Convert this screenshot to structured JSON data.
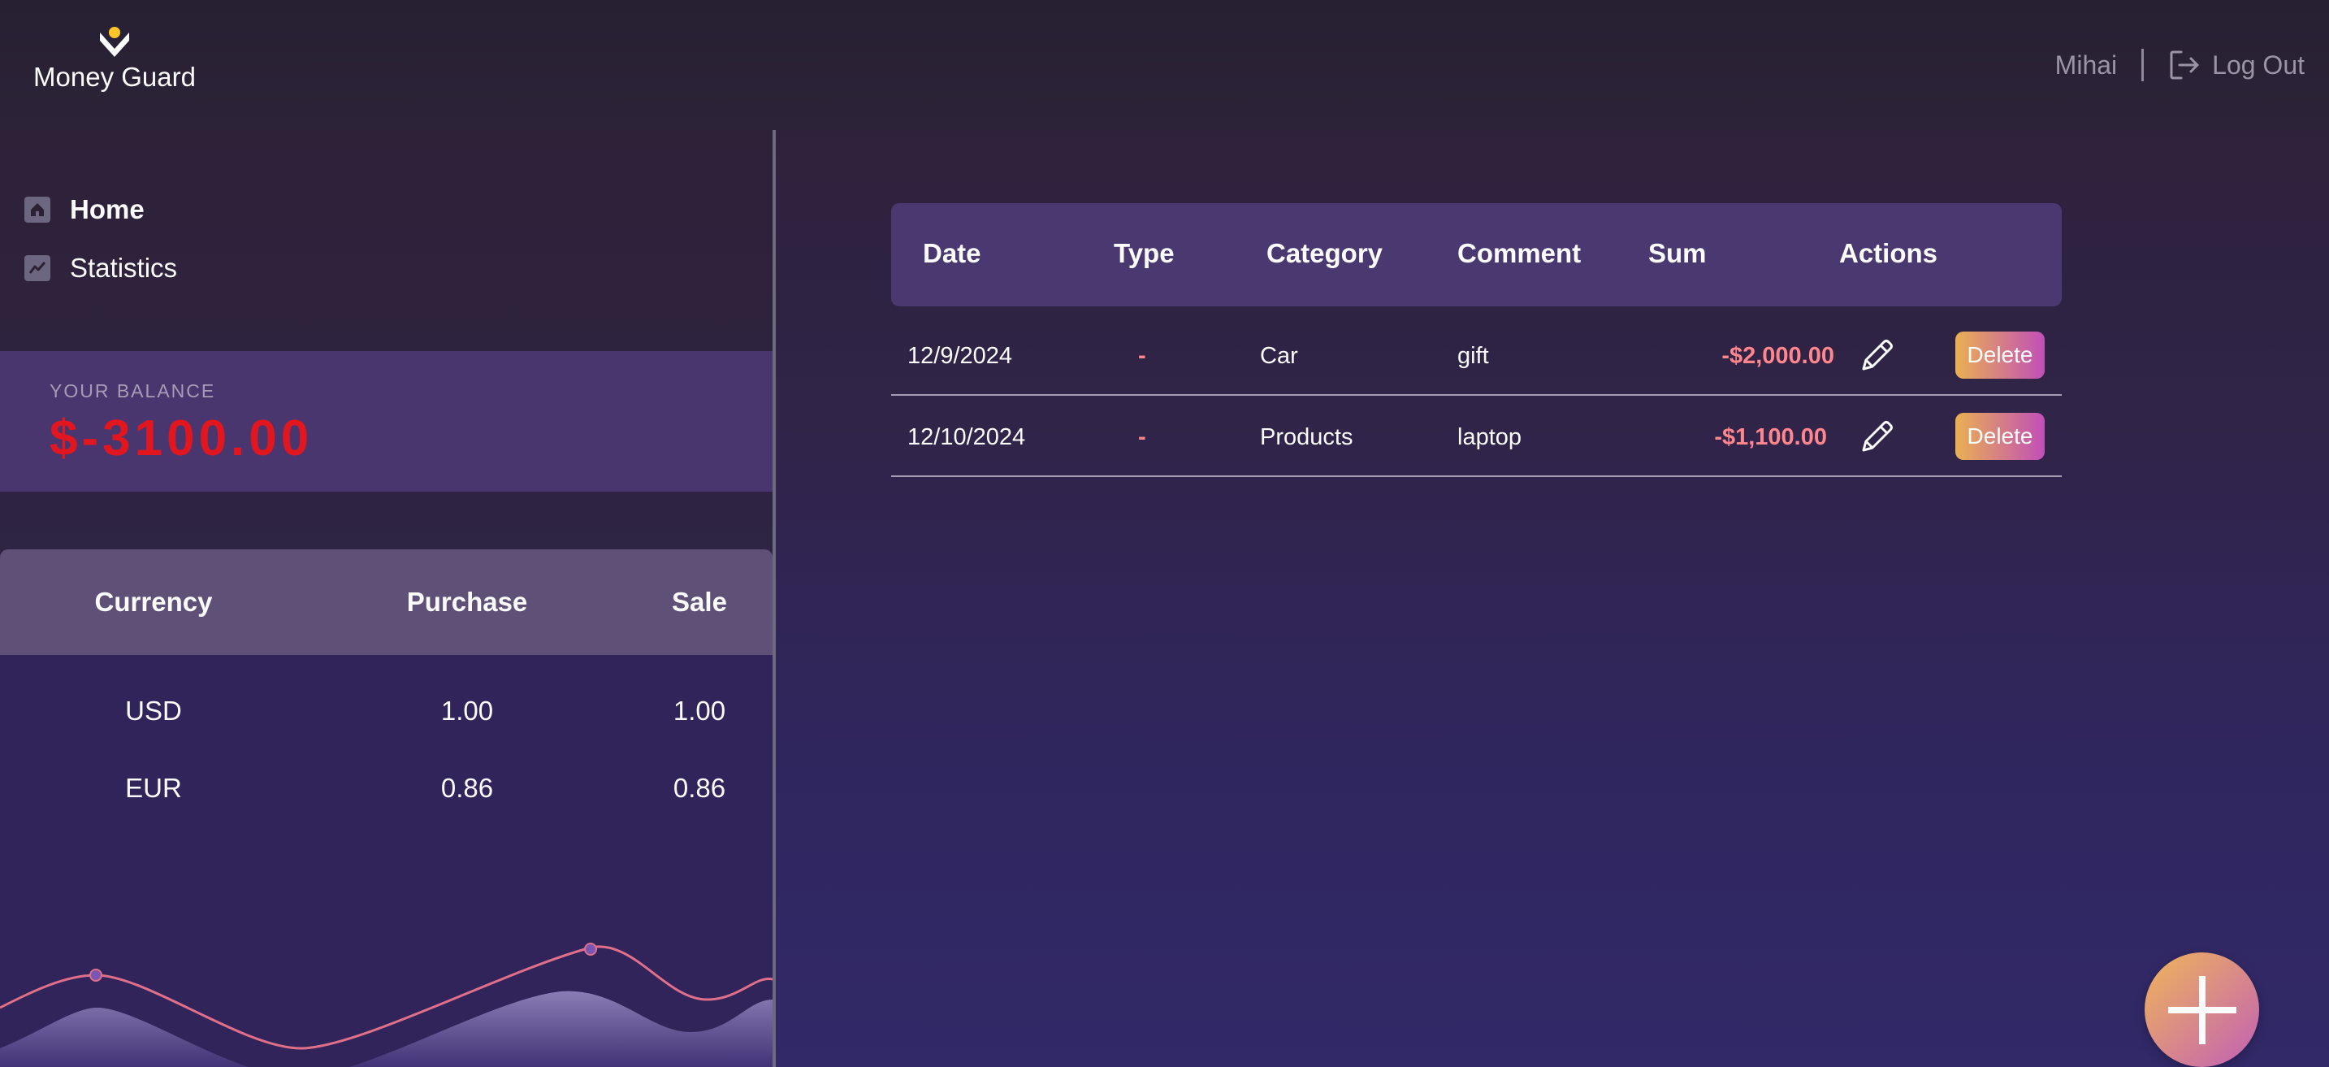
{
  "app": {
    "name": "Money Guard"
  },
  "header": {
    "username": "Mihai",
    "logout_label": "Log Out"
  },
  "sidebar": {
    "nav": [
      {
        "label": "Home",
        "icon": "home-icon",
        "active": true
      },
      {
        "label": "Statistics",
        "icon": "chart-icon",
        "active": false
      }
    ]
  },
  "balance": {
    "label": "YOUR BALANCE",
    "value": "$-3100.00"
  },
  "currency": {
    "headers": [
      "Currency",
      "Purchase",
      "Sale"
    ],
    "rows": [
      {
        "currency": "USD",
        "purchase": "1.00",
        "sale": "1.00"
      },
      {
        "currency": "EUR",
        "purchase": "0.86",
        "sale": "0.86"
      }
    ]
  },
  "transactions": {
    "headers": [
      "Date",
      "Type",
      "Category",
      "Comment",
      "Sum",
      "Actions"
    ],
    "rows": [
      {
        "date": "12/9/2024",
        "type": "-",
        "category": "Car",
        "comment": "gift",
        "sum": "-$2,000.00",
        "delete_label": "Delete"
      },
      {
        "date": "12/10/2024",
        "type": "-",
        "category": "Products",
        "comment": "laptop",
        "sum": "-$1,100.00",
        "delete_label": "Delete"
      }
    ]
  },
  "colors": {
    "balance_negative": "#e2161e",
    "expense_text": "#ff868d",
    "accent_start": "#eab052",
    "accent_end": "#c14fb7"
  },
  "icons": {
    "logo": "money-guard-logo-icon",
    "logout": "logout-icon",
    "edit": "pencil-icon",
    "add": "plus-icon"
  }
}
